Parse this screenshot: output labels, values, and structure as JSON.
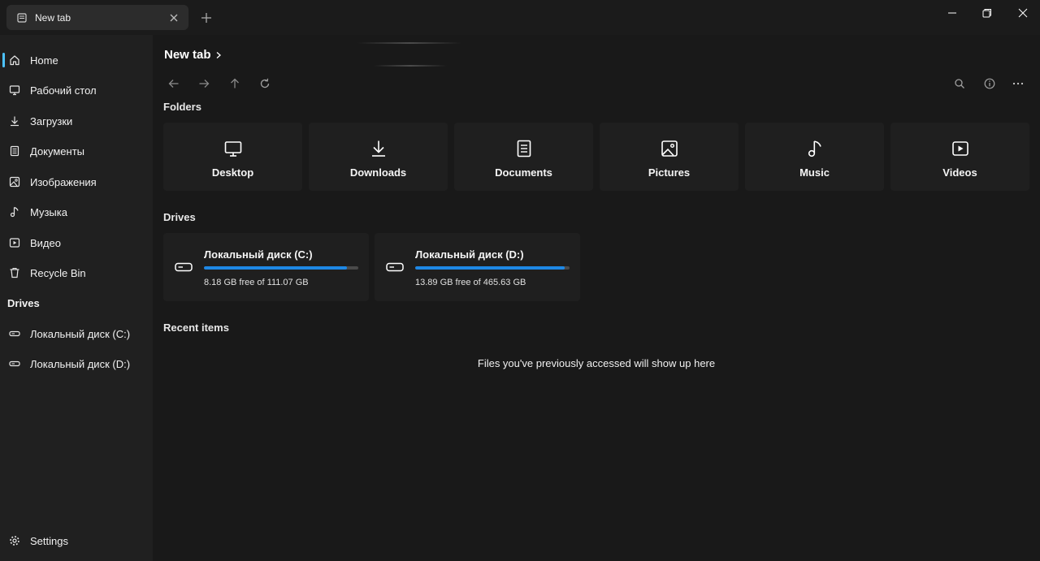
{
  "tab": {
    "title": "New tab",
    "icon": "tab-page-icon"
  },
  "breadcrumb": {
    "current": "New tab"
  },
  "sidebar": {
    "items": [
      {
        "label": "Home",
        "icon": "home-icon"
      },
      {
        "label": "Рабочий стол",
        "icon": "desktop-icon"
      },
      {
        "label": "Загрузки",
        "icon": "download-icon"
      },
      {
        "label": "Документы",
        "icon": "document-icon"
      },
      {
        "label": "Изображения",
        "icon": "image-icon"
      },
      {
        "label": "Музыка",
        "icon": "music-icon"
      },
      {
        "label": "Видео",
        "icon": "video-icon"
      },
      {
        "label": "Recycle Bin",
        "icon": "recycle-bin-icon"
      }
    ],
    "drives_header": "Drives",
    "drives": [
      {
        "label": "Локальный диск (C:)",
        "icon": "drive-icon"
      },
      {
        "label": "Локальный диск (D:)",
        "icon": "drive-icon"
      }
    ],
    "settings_label": "Settings"
  },
  "sections": {
    "folders": "Folders",
    "drives": "Drives",
    "recent": "Recent items"
  },
  "folders": [
    {
      "label": "Desktop",
      "icon": "desktop-icon"
    },
    {
      "label": "Downloads",
      "icon": "download-icon"
    },
    {
      "label": "Documents",
      "icon": "document-icon"
    },
    {
      "label": "Pictures",
      "icon": "image-icon"
    },
    {
      "label": "Music",
      "icon": "music-icon"
    },
    {
      "label": "Videos",
      "icon": "video-icon"
    }
  ],
  "drives": [
    {
      "name": "Локальный диск (C:)",
      "free_text": "8.18 GB free of 111.07 GB",
      "used_fraction": 0.926
    },
    {
      "name": "Локальный диск (D:)",
      "free_text": "13.89 GB free of 465.63 GB",
      "used_fraction": 0.97
    }
  ],
  "recent": {
    "empty_message": "Files you've previously accessed will show up here"
  },
  "colors": {
    "accent": "#4cc2ff",
    "drive_bar": "#1e88e5",
    "background": "#191919",
    "card": "#1f1f1f"
  }
}
